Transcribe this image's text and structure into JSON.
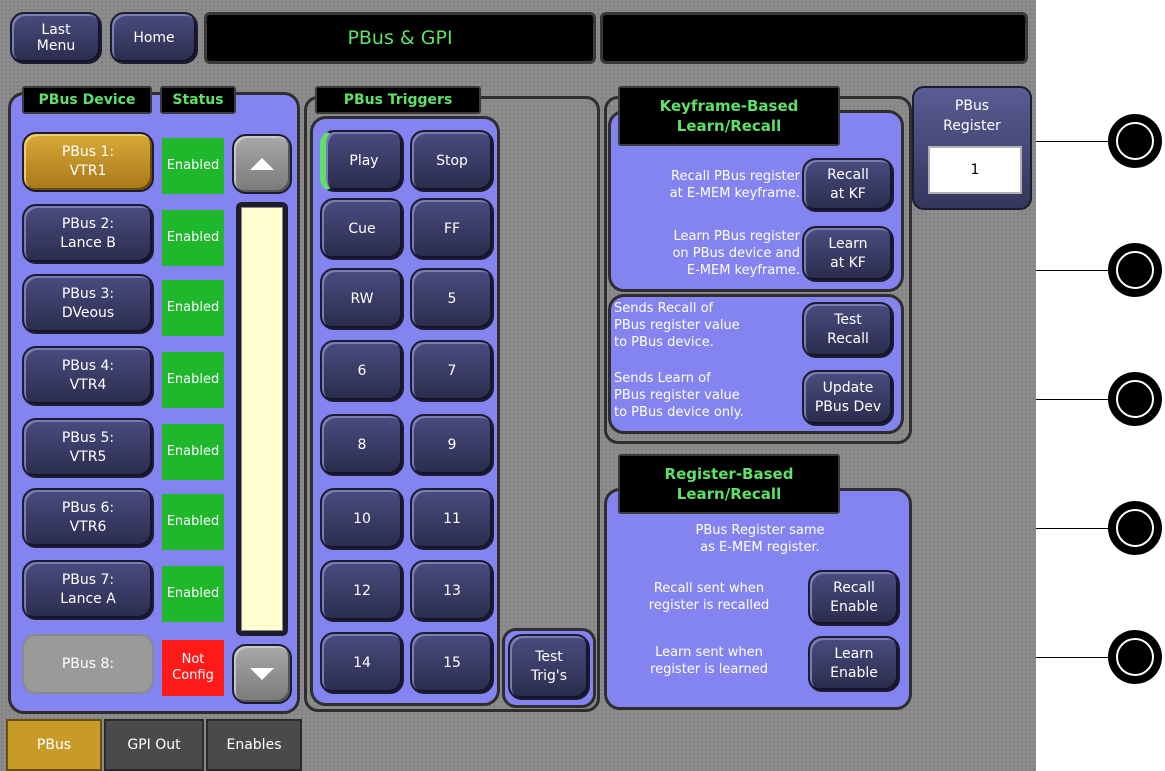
{
  "header": {
    "last_menu": "Last\nMenu",
    "home": "Home",
    "title": "PBus & GPI",
    "right_title": ""
  },
  "device_panel": {
    "device_label": "PBus Device",
    "status_label": "Status",
    "devices": [
      {
        "label": "PBus 1:\nVTR1",
        "status": "Enabled"
      },
      {
        "label": "PBus 2:\nLance B",
        "status": "Enabled"
      },
      {
        "label": "PBus 3:\nDVeous",
        "status": "Enabled"
      },
      {
        "label": "PBus 4:\nVTR4",
        "status": "Enabled"
      },
      {
        "label": "PBus 5:\nVTR5",
        "status": "Enabled"
      },
      {
        "label": "PBus 6:\nVTR6",
        "status": "Enabled"
      },
      {
        "label": "PBus 7:\nLance A",
        "status": "Enabled"
      },
      {
        "label": "PBus 8:",
        "status": "Not\nConfig"
      }
    ]
  },
  "triggers": {
    "label": "PBus Triggers",
    "buttons": [
      "Play",
      "Stop",
      "Cue",
      "FF",
      "RW",
      "5",
      "6",
      "7",
      "8",
      "9",
      "10",
      "11",
      "12",
      "13",
      "14",
      "15"
    ],
    "test": "Test\nTrig's"
  },
  "keyframe": {
    "title": "Keyframe-Based\nLearn/Recall",
    "recall_desc": "Recall PBus register\nat E-MEM keyframe.",
    "recall_btn": "Recall\nat KF",
    "learn_desc": "Learn PBus register\non PBus device and\nE-MEM keyframe.",
    "learn_btn": "Learn\nat KF",
    "test_desc": "Sends Recall of\nPBus register value\nto PBus device.",
    "test_btn": "Test\nRecall",
    "update_desc": "Sends Learn of\nPBus register value\nto PBus device only.",
    "update_btn": "Update\nPBus Dev"
  },
  "register_panel": {
    "label": "PBus\nRegister",
    "value": "1"
  },
  "register_based": {
    "title": "Register-Based\nLearn/Recall",
    "desc": "PBus Register same\nas E-MEM register.",
    "recall_desc": "Recall sent when\nregister is recalled",
    "recall_btn": "Recall\nEnable",
    "learn_desc": "Learn sent when\nregister is learned",
    "learn_btn": "Learn\nEnable"
  },
  "tabs": [
    "PBus",
    "GPI Out",
    "Enables"
  ],
  "colors": {
    "panel": "#8484f0",
    "button": "#34365c",
    "selected": "#c89a28",
    "enabled": "#1fb82c",
    "not_config": "#ff1a1a",
    "title_text": "#5fe06a"
  }
}
